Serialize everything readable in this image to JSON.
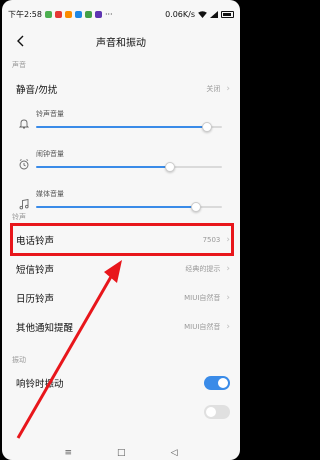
{
  "status": {
    "time": "下午2:58",
    "speed": "0.06K/s"
  },
  "header": {
    "title": "声音和振动"
  },
  "sections": {
    "sound": "声音",
    "ringtone": "铃声",
    "vibration": "振动"
  },
  "dnd": {
    "label": "静音/勿扰",
    "value": "关闭"
  },
  "sliders": [
    {
      "label": "铃声音量",
      "icon": "bell-icon",
      "level": 0.92
    },
    {
      "label": "闹钟音量",
      "icon": "alarm-clock-icon",
      "level": 0.72
    },
    {
      "label": "媒体音量",
      "icon": "music-note-icon",
      "level": 0.86
    }
  ],
  "ringtones": [
    {
      "label": "电话铃声",
      "value": "7503"
    },
    {
      "label": "短信铃声",
      "value": "经典的提示"
    },
    {
      "label": "日历铃声",
      "value": "MIUI自然音"
    },
    {
      "label": "其他通知提醒",
      "value": "MIUI自然音"
    }
  ],
  "vibration_rows": [
    {
      "label": "响铃时振动",
      "on": true
    }
  ],
  "colors": {
    "accent": "#3a8be8",
    "annotation": "#e8161b"
  }
}
